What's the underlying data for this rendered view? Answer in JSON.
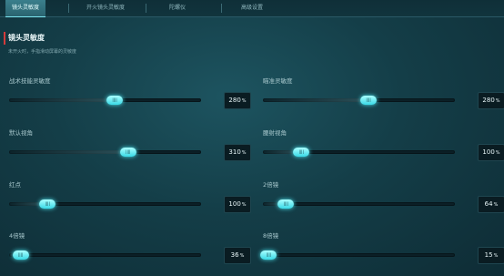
{
  "tabs": [
    {
      "label": "镜头灵敏度",
      "active": true
    },
    {
      "label": "开火镜头灵敏度",
      "active": false
    },
    {
      "label": "陀螺仪",
      "active": false
    },
    {
      "label": "高级设置",
      "active": false
    }
  ],
  "section": {
    "title": "镜头灵敏度",
    "subtitle": "未开火时，手指滑动屏幕的灵敏度"
  },
  "settings": [
    {
      "label": "战术技能灵敏度",
      "value": "280",
      "unit": "%",
      "thumb_text": "||||",
      "level": 0.55
    },
    {
      "label": "瞄准灵敏度",
      "value": "280",
      "unit": "%",
      "thumb_text": "||||",
      "level": 0.55
    },
    {
      "label": "默认视角",
      "value": "310",
      "unit": "%",
      "thumb_text": "||||",
      "level": 0.62
    },
    {
      "label": "腰射视角",
      "value": "100",
      "unit": "%",
      "thumb_text": "||||",
      "level": 0.2
    },
    {
      "label": "红点",
      "value": "100",
      "unit": "%",
      "thumb_text": "||||",
      "level": 0.2
    },
    {
      "label": "2倍镜",
      "value": "64",
      "unit": "%",
      "thumb_text": "||||",
      "level": 0.12
    },
    {
      "label": "4倍镜",
      "value": "36",
      "unit": "%",
      "thumb_text": "||||",
      "level": 0.06
    },
    {
      "label": "8倍镜",
      "value": "15",
      "unit": "%",
      "thumb_text": "||||",
      "level": 0.03
    }
  ],
  "colors": {
    "accent": "#4be6f0",
    "section_marker": "#d33b3b"
  }
}
